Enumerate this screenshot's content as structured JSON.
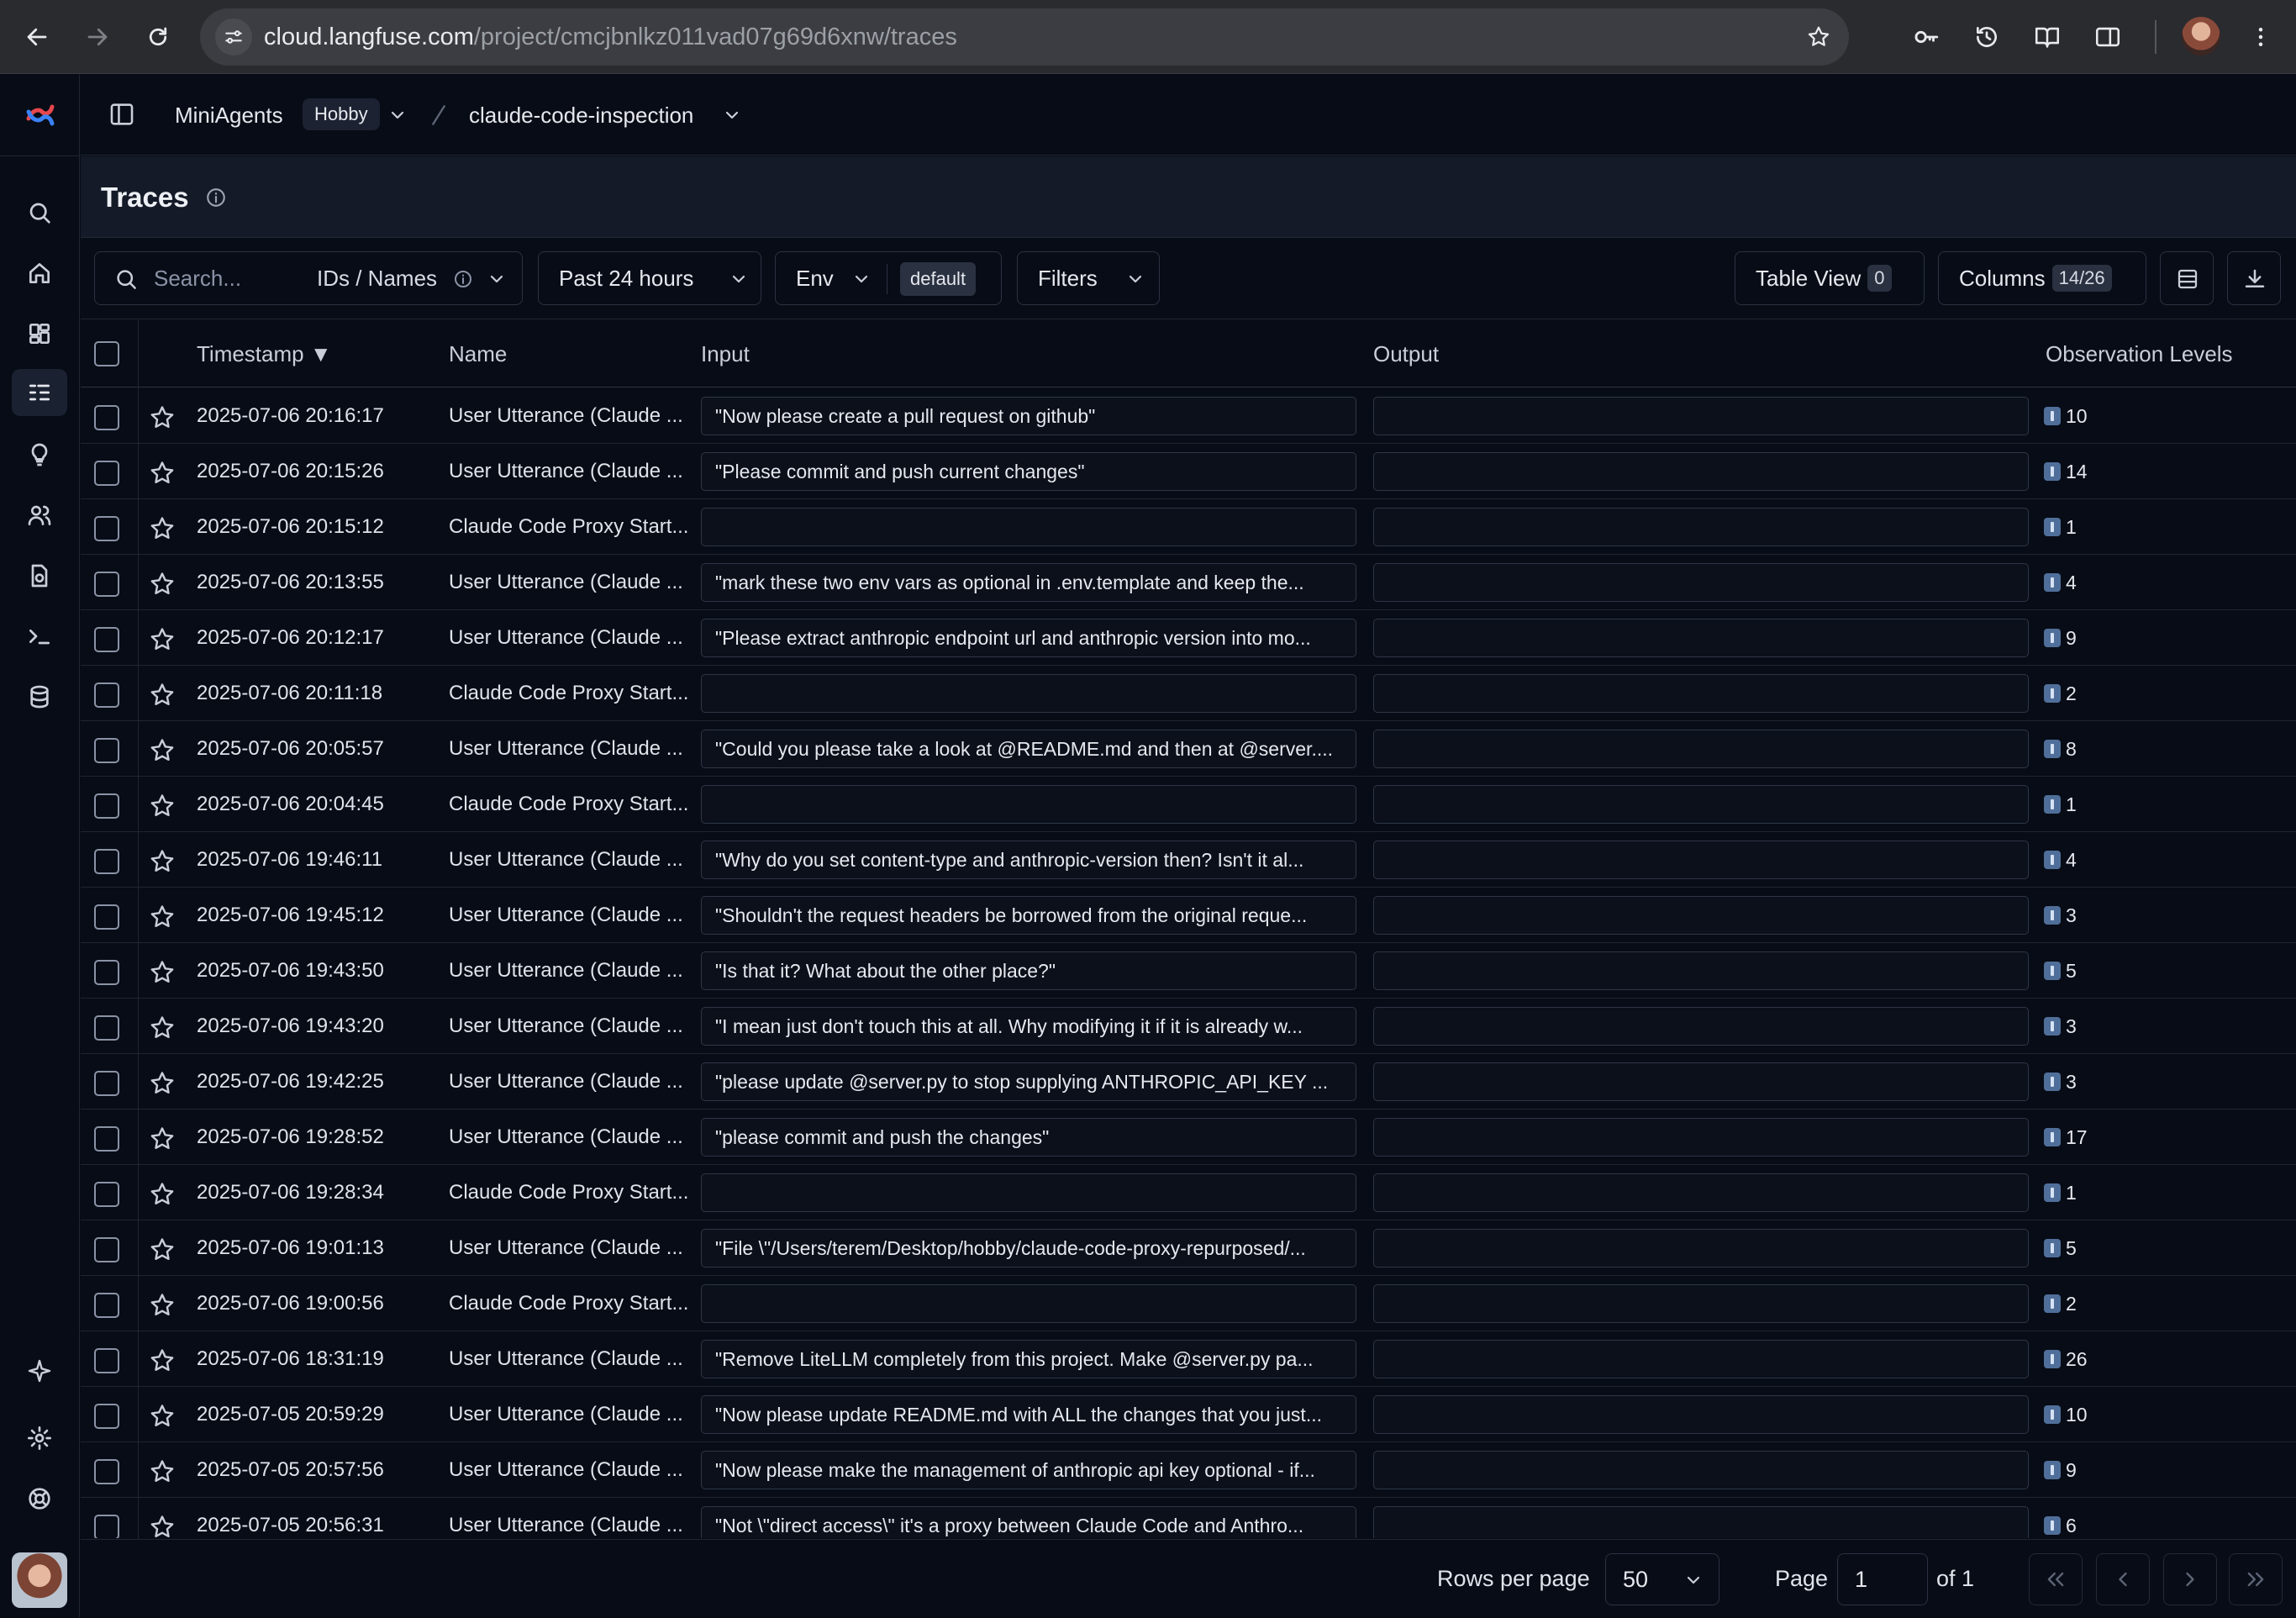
{
  "browser": {
    "url_host": "cloud.langfuse.com",
    "url_path": "/project/cmcjbnlkz011vad07g69d6xnw/traces"
  },
  "header": {
    "org": "MiniAgents",
    "plan": "Hobby",
    "project": "claude-code-inspection"
  },
  "page": {
    "title": "Traces"
  },
  "toolbar": {
    "search_placeholder": "Search...",
    "search_mode": "IDs / Names",
    "time_range": "Past 24 hours",
    "env_label": "Env",
    "env_value": "default",
    "filters_label": "Filters",
    "table_view_label": "Table View",
    "table_view_count": "0",
    "columns_label": "Columns",
    "columns_count": "14/26"
  },
  "table": {
    "columns": {
      "timestamp": "Timestamp ▼",
      "name": "Name",
      "input": "Input",
      "output": "Output",
      "levels": "Observation Levels"
    },
    "rows": [
      {
        "timestamp": "2025-07-06 20:16:17",
        "name": "User Utterance (Claude ...",
        "input": "\"Now please create a pull request on github\"",
        "level": "10"
      },
      {
        "timestamp": "2025-07-06 20:15:26",
        "name": "User Utterance (Claude ...",
        "input": "\"Please commit and push current changes\"",
        "level": "14"
      },
      {
        "timestamp": "2025-07-06 20:15:12",
        "name": "Claude Code Proxy Start...",
        "input": "",
        "level": "1"
      },
      {
        "timestamp": "2025-07-06 20:13:55",
        "name": "User Utterance (Claude ...",
        "input": "\"mark these two env vars as optional in .env.template and keep the...",
        "level": "4"
      },
      {
        "timestamp": "2025-07-06 20:12:17",
        "name": "User Utterance (Claude ...",
        "input": "\"Please extract anthropic endpoint url and anthropic version into mo...",
        "level": "9"
      },
      {
        "timestamp": "2025-07-06 20:11:18",
        "name": "Claude Code Proxy Start...",
        "input": "",
        "level": "2"
      },
      {
        "timestamp": "2025-07-06 20:05:57",
        "name": "User Utterance (Claude ...",
        "input": "\"Could you please take a look at @README.md and then at @server....",
        "level": "8"
      },
      {
        "timestamp": "2025-07-06 20:04:45",
        "name": "Claude Code Proxy Start...",
        "input": "",
        "level": "1"
      },
      {
        "timestamp": "2025-07-06 19:46:11",
        "name": "User Utterance (Claude ...",
        "input": "\"Why do you set content-type and anthropic-version then? Isn't it al...",
        "level": "4"
      },
      {
        "timestamp": "2025-07-06 19:45:12",
        "name": "User Utterance (Claude ...",
        "input": "\"Shouldn't the request headers be borrowed from the original reque...",
        "level": "3"
      },
      {
        "timestamp": "2025-07-06 19:43:50",
        "name": "User Utterance (Claude ...",
        "input": "\"Is that it? What about the other place?\"",
        "level": "5"
      },
      {
        "timestamp": "2025-07-06 19:43:20",
        "name": "User Utterance (Claude ...",
        "input": "\"I mean just don't touch this at all. Why modifying it if it is already w...",
        "level": "3"
      },
      {
        "timestamp": "2025-07-06 19:42:25",
        "name": "User Utterance (Claude ...",
        "input": "\"please update @server.py to stop supplying ANTHROPIC_API_KEY ...",
        "level": "3"
      },
      {
        "timestamp": "2025-07-06 19:28:52",
        "name": "User Utterance (Claude ...",
        "input": "\"please commit and push the changes\"",
        "level": "17"
      },
      {
        "timestamp": "2025-07-06 19:28:34",
        "name": "Claude Code Proxy Start...",
        "input": "",
        "level": "1"
      },
      {
        "timestamp": "2025-07-06 19:01:13",
        "name": "User Utterance (Claude ...",
        "input": "\"File \\\"/Users/terem/Desktop/hobby/claude-code-proxy-repurposed/...",
        "level": "5"
      },
      {
        "timestamp": "2025-07-06 19:00:56",
        "name": "Claude Code Proxy Start...",
        "input": "",
        "level": "2"
      },
      {
        "timestamp": "2025-07-06 18:31:19",
        "name": "User Utterance (Claude ...",
        "input": "\"Remove LiteLLM completely from this project. Make @server.py pa...",
        "level": "26"
      },
      {
        "timestamp": "2025-07-05 20:59:29",
        "name": "User Utterance (Claude ...",
        "input": "\"Now please update README.md with ALL the changes that you just...",
        "level": "10"
      },
      {
        "timestamp": "2025-07-05 20:57:56",
        "name": "User Utterance (Claude ...",
        "input": "\"Now please make the management of anthropic api key optional - if...",
        "level": "9"
      },
      {
        "timestamp": "2025-07-05 20:56:31",
        "name": "User Utterance (Claude ...",
        "input": "\"Not \\\"direct access\\\" it's a proxy between Claude Code and Anthro...",
        "level": "6"
      }
    ]
  },
  "footer": {
    "rows_per_page_label": "Rows per page",
    "rows_per_page": "50",
    "page_label": "Page",
    "page_value": "1",
    "of_pages": "of 1"
  }
}
